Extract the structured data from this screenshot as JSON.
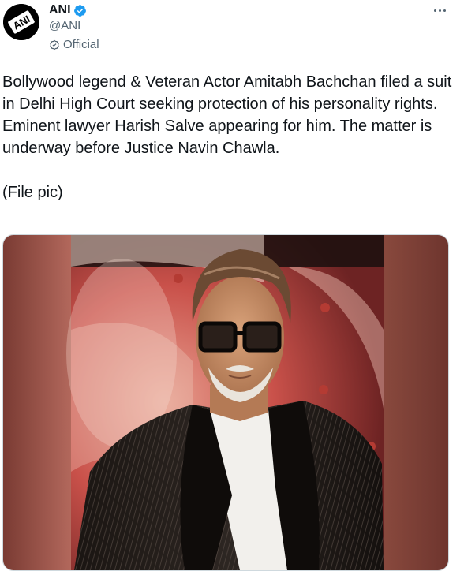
{
  "account": {
    "display_name": "ANI",
    "handle": "@ANI",
    "official_label": "Official",
    "avatar_text": "ANI"
  },
  "icons": {
    "verified": "verified-badge-icon",
    "official": "official-check-icon",
    "more": "more-options-icon"
  },
  "tweet": {
    "text": "Bollywood legend & Veteran Actor Amitabh Bachchan filed a suit in Delhi High Court seeking protection of his personality rights. Eminent lawyer Harish Salve appearing for him. The matter is underway before Justice Navin Chawla.",
    "caption": "(File pic)"
  },
  "colors": {
    "verified_blue": "#1d9bf0",
    "secondary_text": "#536471",
    "primary_text": "#0f1419"
  }
}
